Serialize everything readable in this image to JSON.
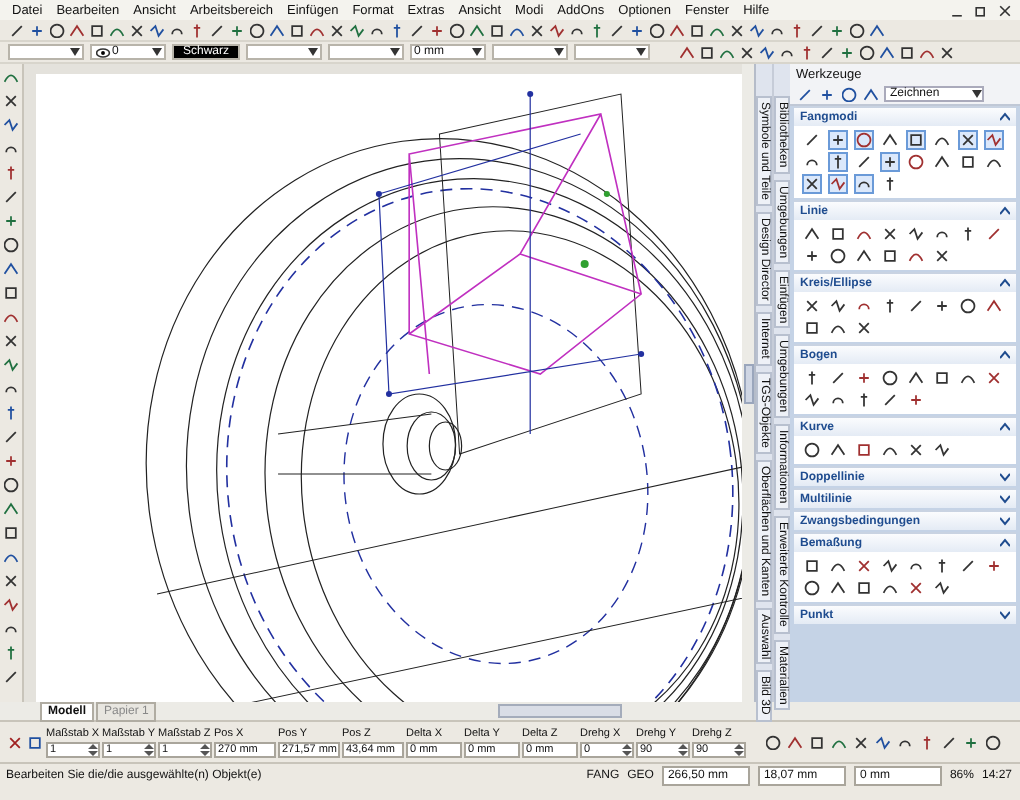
{
  "menu": [
    "Datei",
    "Bearbeiten",
    "Ansicht",
    "Arbeitsbereich",
    "Einfügen",
    "Format",
    "Extras",
    "Ansicht",
    "Modi",
    "AddOns",
    "Optionen",
    "Fenster",
    "Hilfe"
  ],
  "style_bar": [
    {
      "kind": "plain"
    },
    {
      "kind": "layer",
      "value": "0"
    },
    {
      "kind": "color",
      "value": "Schwarz"
    },
    {
      "kind": "plain"
    },
    {
      "kind": "plain"
    },
    {
      "kind": "plain",
      "value": "0 mm"
    },
    {
      "kind": "plain"
    },
    {
      "kind": "plain"
    }
  ],
  "side_tabs_1": [
    "Symbole und Teile",
    "Design Director",
    "Internet",
    "TGS-Objekte",
    "Oberflächen und Kanten",
    "Auswahl",
    "Bild 3D"
  ],
  "side_tabs_2": [
    "Bibliotheken",
    "Umgebungen",
    "Einfügen",
    "Umgebungen",
    "Informationen",
    "Erweiterte Kontrolle",
    "Materialien"
  ],
  "tool_palette": {
    "title": "Werkzeuge",
    "mode": "Zeichnen",
    "sections": [
      {
        "title": "Fangmodi",
        "expanded": true,
        "tools": [
          {
            "selected": false
          },
          {
            "selected": true
          },
          {
            "selected": true
          },
          {
            "selected": false
          },
          {
            "selected": true
          },
          {
            "selected": false
          },
          {
            "selected": true
          },
          {
            "selected": true
          },
          {
            "selected": false
          },
          {
            "selected": true
          },
          {
            "selected": false
          },
          {
            "selected": true
          },
          {
            "selected": false
          },
          {
            "selected": false
          },
          {
            "selected": false
          },
          {
            "selected": false
          },
          {
            "selected": true
          },
          {
            "selected": true
          },
          {
            "selected": true
          },
          {
            "selected": false
          }
        ]
      },
      {
        "title": "Linie",
        "expanded": true,
        "tools": [
          {
            "selected": false
          },
          {
            "selected": false
          },
          {
            "selected": false
          },
          {
            "selected": false
          },
          {
            "selected": false
          },
          {
            "selected": false
          },
          {
            "selected": false
          },
          {
            "selected": false
          },
          {
            "selected": false
          },
          {
            "selected": false
          },
          {
            "selected": false
          },
          {
            "selected": false
          },
          {
            "selected": false
          },
          {
            "selected": false
          }
        ]
      },
      {
        "title": "Kreis/Ellipse",
        "expanded": true,
        "tools": [
          {
            "selected": false
          },
          {
            "selected": false
          },
          {
            "selected": false
          },
          {
            "selected": false
          },
          {
            "selected": false
          },
          {
            "selected": false
          },
          {
            "selected": false
          },
          {
            "selected": false
          },
          {
            "selected": false
          },
          {
            "selected": false
          },
          {
            "selected": false
          }
        ]
      },
      {
        "title": "Bogen",
        "expanded": true,
        "tools": [
          {
            "selected": false
          },
          {
            "selected": false
          },
          {
            "selected": false
          },
          {
            "selected": false
          },
          {
            "selected": false
          },
          {
            "selected": false
          },
          {
            "selected": false
          },
          {
            "selected": false
          },
          {
            "selected": false
          },
          {
            "selected": false
          },
          {
            "selected": false
          },
          {
            "selected": false
          },
          {
            "selected": false
          }
        ]
      },
      {
        "title": "Kurve",
        "expanded": true,
        "tools": [
          {
            "selected": false
          },
          {
            "selected": false
          },
          {
            "selected": false
          },
          {
            "selected": false
          },
          {
            "selected": false
          },
          {
            "selected": false
          }
        ]
      },
      {
        "title": "Doppellinie",
        "expanded": false
      },
      {
        "title": "Multilinie",
        "expanded": false
      },
      {
        "title": "Zwangsbedingungen",
        "expanded": false
      },
      {
        "title": "Bemaßung",
        "expanded": true,
        "tools": [
          {
            "selected": false
          },
          {
            "selected": false
          },
          {
            "selected": false
          },
          {
            "selected": false
          },
          {
            "selected": false
          },
          {
            "selected": false
          },
          {
            "selected": false
          },
          {
            "selected": false
          },
          {
            "selected": false
          },
          {
            "selected": false
          },
          {
            "selected": false
          },
          {
            "selected": false
          },
          {
            "selected": false
          },
          {
            "selected": false
          }
        ]
      },
      {
        "title": "Punkt",
        "expanded": false
      }
    ]
  },
  "sheet_tabs": [
    {
      "label": "Modell",
      "selected": true
    },
    {
      "label": "Papier 1",
      "selected": false
    }
  ],
  "properties": [
    {
      "label": "Maßstab X",
      "value": "1",
      "kind": "spin"
    },
    {
      "label": "Maßstab Y",
      "value": "1",
      "kind": "spin"
    },
    {
      "label": "Maßstab Z",
      "value": "1",
      "kind": "spin"
    },
    {
      "label": "Pos X",
      "value": "270 mm",
      "kind": "text"
    },
    {
      "label": "Pos Y",
      "value": "271,57 mm",
      "kind": "text"
    },
    {
      "label": "Pos Z",
      "value": "43,64 mm",
      "kind": "text"
    },
    {
      "label": "Delta X",
      "value": "0 mm",
      "kind": "text"
    },
    {
      "label": "Delta Y",
      "value": "0 mm",
      "kind": "text"
    },
    {
      "label": "Delta Z",
      "value": "0 mm",
      "kind": "text"
    },
    {
      "label": "Drehg X",
      "value": "0",
      "kind": "spin"
    },
    {
      "label": "Drehg Y",
      "value": "90",
      "kind": "spin"
    },
    {
      "label": "Drehg Z",
      "value": "90",
      "kind": "spin"
    }
  ],
  "status_bar": {
    "message": "Bearbeiten Sie die/die ausgewählte(n) Objekt(e)",
    "modes": [
      "FANG",
      "GEO"
    ],
    "coordinates": [
      "266,50 mm",
      "18,07 mm",
      "0 mm"
    ],
    "zoom": "86%",
    "time": "14:27"
  }
}
